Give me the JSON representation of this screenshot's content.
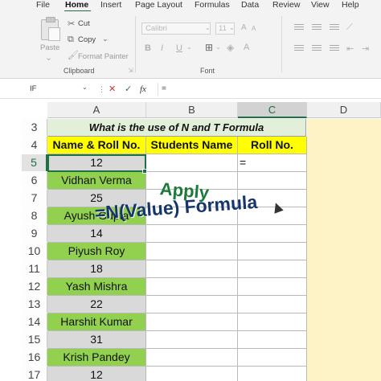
{
  "ribbon": {
    "tabs": [
      "File",
      "Home",
      "Insert",
      "Page Layout",
      "Formulas",
      "Data",
      "Review",
      "View",
      "Help"
    ],
    "active_tab": "Home",
    "clipboard": {
      "paste": "Paste",
      "cut": "Cut",
      "copy": "Copy",
      "format_painter": "Format Painter",
      "group_label": "Clipboard"
    },
    "font": {
      "name": "Calibri",
      "size": "11",
      "bold": "B",
      "italic": "I",
      "underline": "U",
      "group_label": "Font"
    }
  },
  "formula_bar": {
    "name_box": "IF",
    "cancel": "✕",
    "enter": "✓",
    "fx": "fx",
    "value": "="
  },
  "columns": [
    "A",
    "B",
    "C",
    "D"
  ],
  "selected_column": "C",
  "rows": [
    "3",
    "4",
    "5",
    "6",
    "7",
    "8",
    "9",
    "10",
    "11",
    "12",
    "13",
    "14",
    "15",
    "16",
    "17"
  ],
  "selected_row": "5",
  "sheet": {
    "title": "What is the use of N and T Formula",
    "headers": [
      "Name & Roll No.",
      "Students Name",
      "Roll No."
    ],
    "column_a": [
      "12",
      "Vidhan Verma",
      "25",
      "Ayush Gupta",
      "14",
      "Piyush Roy",
      "18",
      "Yash Mishra",
      "22",
      "Harshit Kumar",
      "31",
      "Krish Pandey",
      "12"
    ],
    "editing_cell": "="
  },
  "overlay": {
    "line1": "Apply",
    "line2": "=N(Value) Formula"
  },
  "colors": {
    "excel_green": "#1e7145",
    "cell_green": "#92d050",
    "cell_grey": "#d9d9d9",
    "header_yellow": "#ffff00",
    "title_fill": "#e2efd9",
    "overlay_green": "#1d7a3b",
    "overlay_blue": "#16356b"
  }
}
